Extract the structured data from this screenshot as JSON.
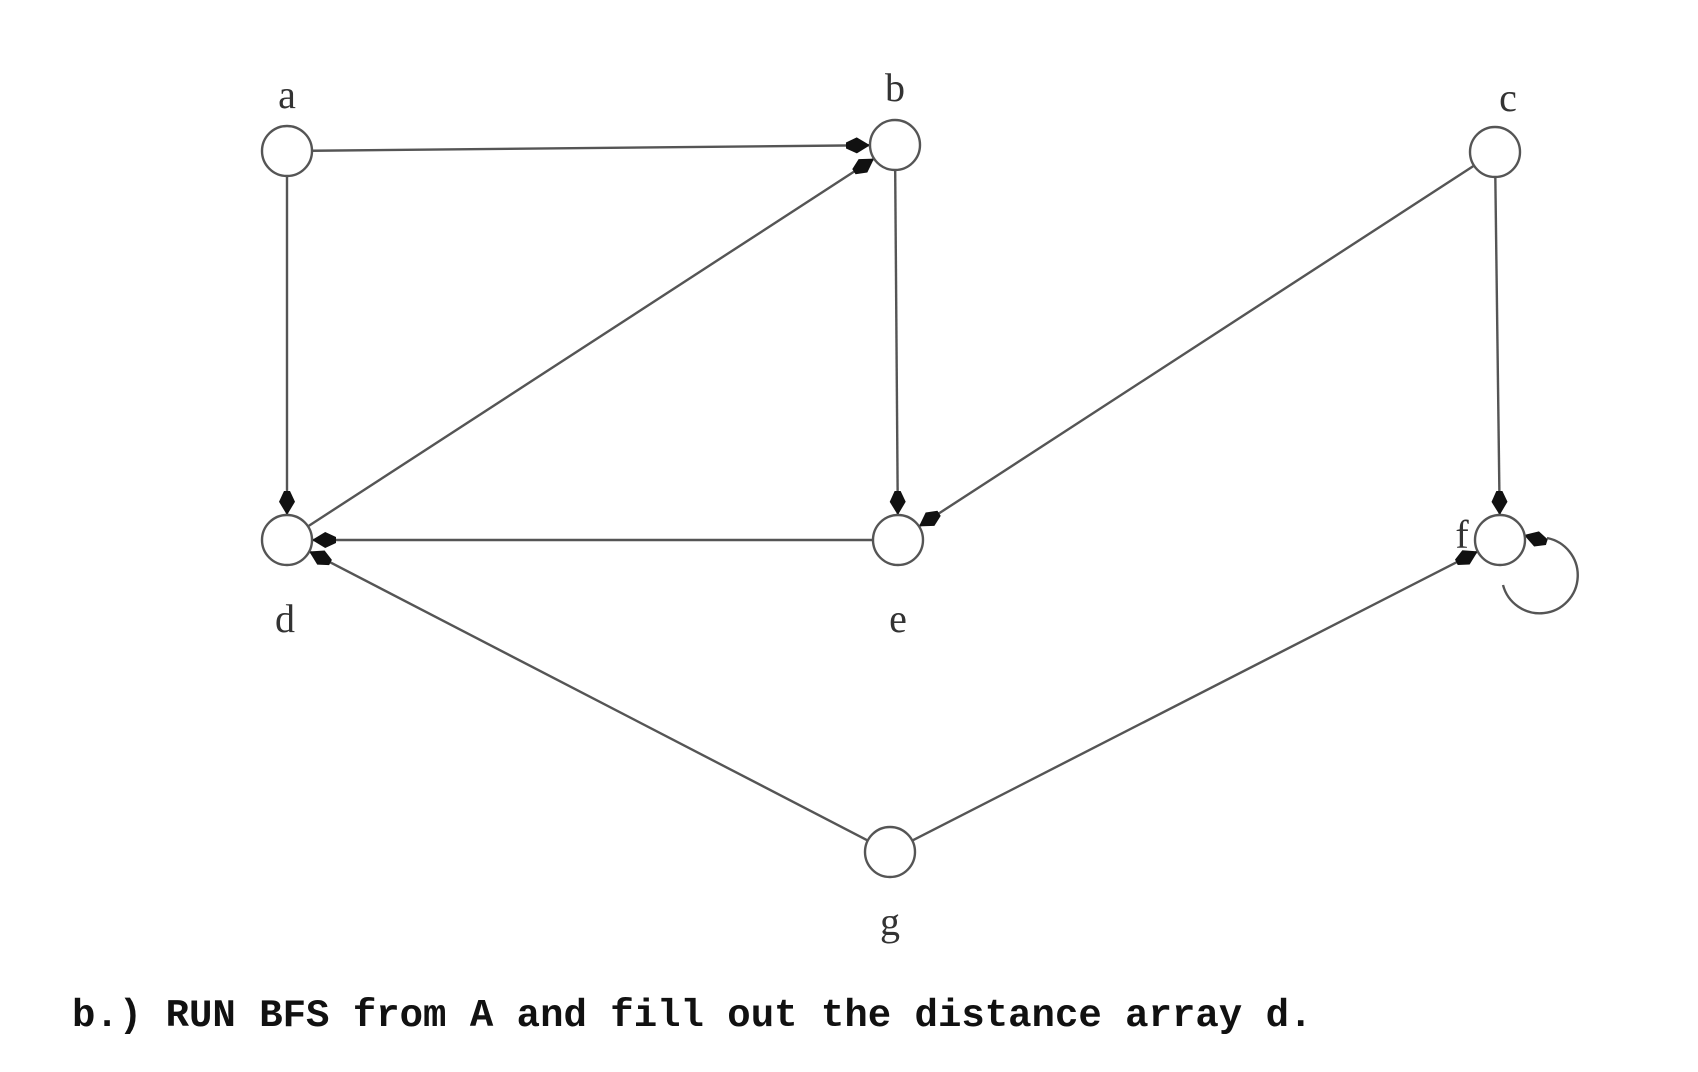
{
  "diagram": {
    "type": "directed-graph",
    "nodes": [
      {
        "id": "a",
        "label": "a"
      },
      {
        "id": "b",
        "label": "b"
      },
      {
        "id": "c",
        "label": "c"
      },
      {
        "id": "d",
        "label": "d"
      },
      {
        "id": "e",
        "label": "e"
      },
      {
        "id": "f",
        "label": "f"
      },
      {
        "id": "g",
        "label": "g"
      }
    ],
    "edges": [
      {
        "from": "a",
        "to": "b"
      },
      {
        "from": "a",
        "to": "d"
      },
      {
        "from": "b",
        "to": "e"
      },
      {
        "from": "d",
        "to": "b"
      },
      {
        "from": "e",
        "to": "d"
      },
      {
        "from": "c",
        "to": "e"
      },
      {
        "from": "c",
        "to": "f"
      },
      {
        "from": "f",
        "to": "f"
      },
      {
        "from": "g",
        "to": "d"
      },
      {
        "from": "g",
        "to": "f"
      }
    ]
  },
  "question": {
    "text": "b.) RUN BFS from A and fill out the distance array d."
  }
}
